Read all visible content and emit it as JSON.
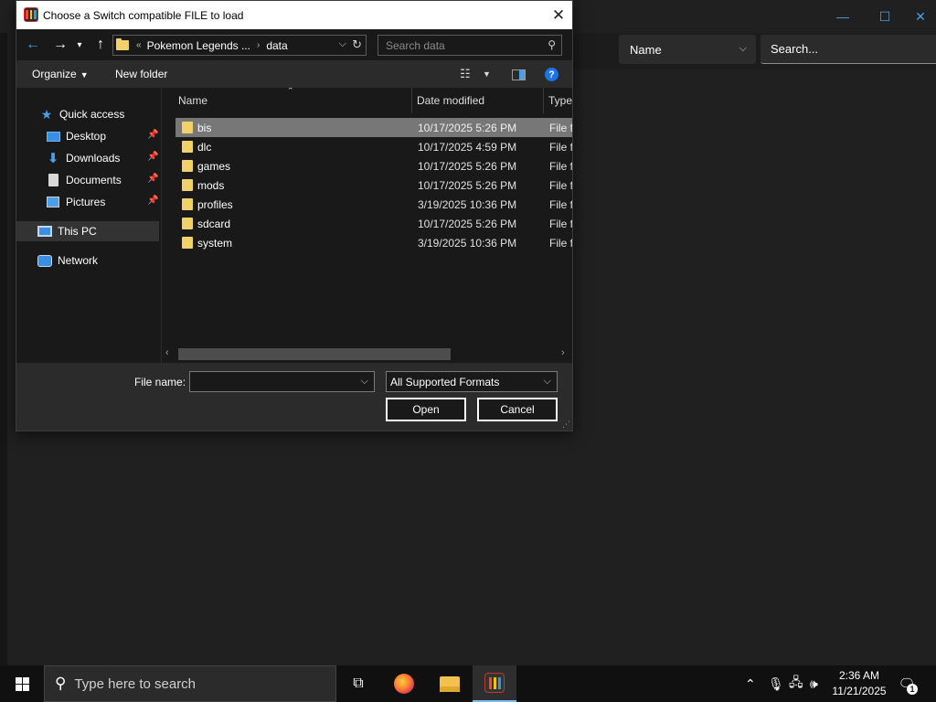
{
  "background_app": {
    "window_controls": {
      "minimize": "—",
      "maximize": "☐",
      "close": "✕"
    },
    "sort_select": {
      "value": "Name"
    },
    "search": {
      "placeholder": "Search..."
    }
  },
  "dialog": {
    "title": "Choose a Switch compatible FILE to load",
    "address_bar": {
      "overflow_marker": "«",
      "crumbs": [
        "Pokemon Legends ...",
        "data"
      ]
    },
    "search": {
      "placeholder": "Search data"
    },
    "commands": {
      "organize": "Organize",
      "new_folder": "New folder"
    },
    "nav_pane": {
      "items": [
        {
          "label": "Quick access",
          "icon": "star-icon"
        },
        {
          "label": "Desktop",
          "icon": "desktop-icon",
          "pinned": true
        },
        {
          "label": "Downloads",
          "icon": "download-icon",
          "pinned": true
        },
        {
          "label": "Documents",
          "icon": "documents-icon",
          "pinned": true
        },
        {
          "label": "Pictures",
          "icon": "pictures-icon",
          "pinned": true
        },
        {
          "label": "This PC",
          "icon": "computer-icon",
          "selected": true
        },
        {
          "label": "Network",
          "icon": "network-icon"
        }
      ]
    },
    "file_list": {
      "columns": [
        "Name",
        "Date modified",
        "Type"
      ],
      "rows": [
        {
          "name": "bis",
          "date": "10/17/2025 5:26 PM",
          "type": "File folder",
          "selected": true
        },
        {
          "name": "dlc",
          "date": "10/17/2025 4:59 PM",
          "type": "File folder"
        },
        {
          "name": "games",
          "date": "10/17/2025 5:26 PM",
          "type": "File folder"
        },
        {
          "name": "mods",
          "date": "10/17/2025 5:26 PM",
          "type": "File folder"
        },
        {
          "name": "profiles",
          "date": "3/19/2025 10:36 PM",
          "type": "File folder"
        },
        {
          "name": "sdcard",
          "date": "10/17/2025 5:26 PM",
          "type": "File folder"
        },
        {
          "name": "system",
          "date": "3/19/2025 10:36 PM",
          "type": "File folder"
        }
      ]
    },
    "file_name": {
      "label": "File name:",
      "value": ""
    },
    "file_type": {
      "value": "All Supported Formats"
    },
    "buttons": {
      "open": "Open",
      "cancel": "Cancel"
    }
  },
  "taskbar": {
    "search_placeholder": "Type here to search",
    "time": "2:36 AM",
    "date": "11/21/2025",
    "notification_count": "1"
  }
}
